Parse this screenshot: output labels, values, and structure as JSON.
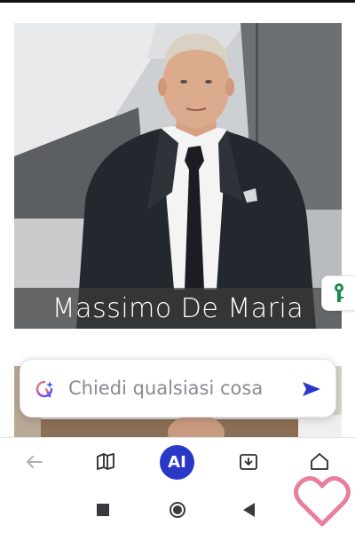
{
  "article": {
    "person_name": "Massimo De Maria"
  },
  "ai_box": {
    "placeholder": "Chiedi qualsiasi cosa"
  },
  "toolbar": {
    "ai_label": "AI"
  },
  "icons": {
    "ai_sparkle": "ai-sparkle-icon",
    "send": "send-icon",
    "back": "back-arrow-icon",
    "reader": "book-icon",
    "downloads": "download-icon",
    "home": "home-icon",
    "key": "key-icon",
    "heart": "heart-icon"
  },
  "colors": {
    "accent": "#2a38c8",
    "key_green": "#1a8a4a",
    "heart_pink": "#e46a8a"
  }
}
